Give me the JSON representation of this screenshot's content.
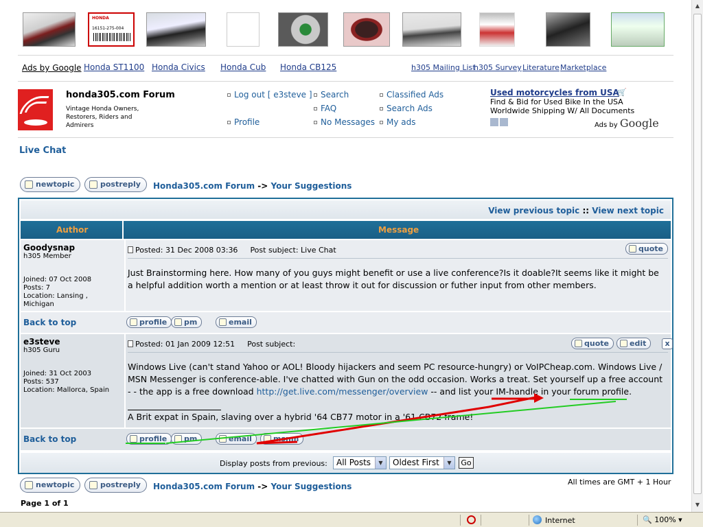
{
  "top_nav": {
    "ads_by_google": "Ads by Google",
    "ad_links": [
      "Honda ST1100",
      "Honda Civics",
      "Honda Cub",
      "Honda CB125"
    ],
    "site_links": [
      "h305 Mailing List",
      "h305 Survey",
      "Literature",
      "Marketplace"
    ]
  },
  "photo_strip": {
    "part_tag_brand": "HONDA",
    "part_tag_number": "16151-275-004"
  },
  "header": {
    "title": "honda305.com Forum",
    "description": "Vintage Honda Owners, Restorers, Riders and Admirers",
    "nav": {
      "logout": "Log out [ e3steve ]",
      "search": "Search",
      "classified": "Classified Ads",
      "faq": "FAQ",
      "search_ads": "Search Ads",
      "profile": "Profile",
      "no_messages": "No Messages",
      "my_ads": "My ads"
    },
    "ad": {
      "title": "Used motorcycles from USA",
      "line1": "Find & Bid for Used Bike In the USA",
      "line2": "Worldwide Shipping W/ All Documents",
      "ads_by": "Ads by",
      "google": "Google"
    }
  },
  "topic_title": "Live Chat",
  "buttons": {
    "new_topic": "newtopic",
    "post_reply": "postreply"
  },
  "breadcrumb": {
    "forum": "Honda305.com Forum",
    "sep": "->",
    "section": "Your Suggestions"
  },
  "topic_nav": {
    "prev": "View previous topic",
    "sep": "::",
    "next": "View next topic"
  },
  "table_headers": {
    "author": "Author",
    "message": "Message"
  },
  "posts": [
    {
      "author": "Goodysnap",
      "rank": "h305 Member",
      "joined": "Joined: 07 Oct 2008",
      "posts": "Posts: 7",
      "location": "Location: Lansing , Michigan",
      "posted": "Posted: 31 Dec 2008 03:36",
      "subject": "Post subject: Live Chat",
      "body": "Just Brainstorming here. How many of you guys might benefit or use a live conference?Is it doable?It seems like it might be a helpful addition worth a mention or at least throw it out for discussion or futher input from other members.",
      "quote": "quote",
      "back_to_top": "Back to top",
      "profile": "profile",
      "pm": "pm",
      "email": "email"
    },
    {
      "author": "e3steve",
      "rank": "h305 Guru",
      "joined": "Joined: 31 Oct 2003",
      "posts": "Posts: 537",
      "location": "Location: Mallorca, Spain",
      "posted": "Posted: 01 Jan 2009 12:51",
      "subject": "Post subject:",
      "body_part1": "Windows Live (can't stand Yahoo or AOL! Bloody hijackers and seem PC resource-hungry) or VoIPCheap.com. Windows Live / MSN Messenger is conference-able. I've chatted with Gun on the odd occasion. Works a treat. Set yourself up a free account - - the app is a free download ",
      "link": "http://get.live.com/messenger/overview",
      "body_part2": " -- and list your IM-handle in your forum profile.",
      "signature": "A Brit expat in Spain, slaving over a hybrid '64 CB77 motor in a '61 CB72 frame!",
      "quote": "quote",
      "edit": "edit",
      "delete": "x",
      "back_to_top": "Back to top",
      "profile": "profile",
      "pm": "pm",
      "email": "email",
      "msnm": "msnm"
    }
  ],
  "footer_bar": {
    "label": "Display posts from previous:",
    "range": "All Posts",
    "order": "Oldest First",
    "go": "Go"
  },
  "timezone": "All times are GMT + 1 Hour",
  "pagination": "Page 1 of 1",
  "statusbar": {
    "zone": "Internet",
    "zoom": "100%"
  },
  "annotation_colors": {
    "red": "#e00000",
    "green": "#22cc22"
  }
}
